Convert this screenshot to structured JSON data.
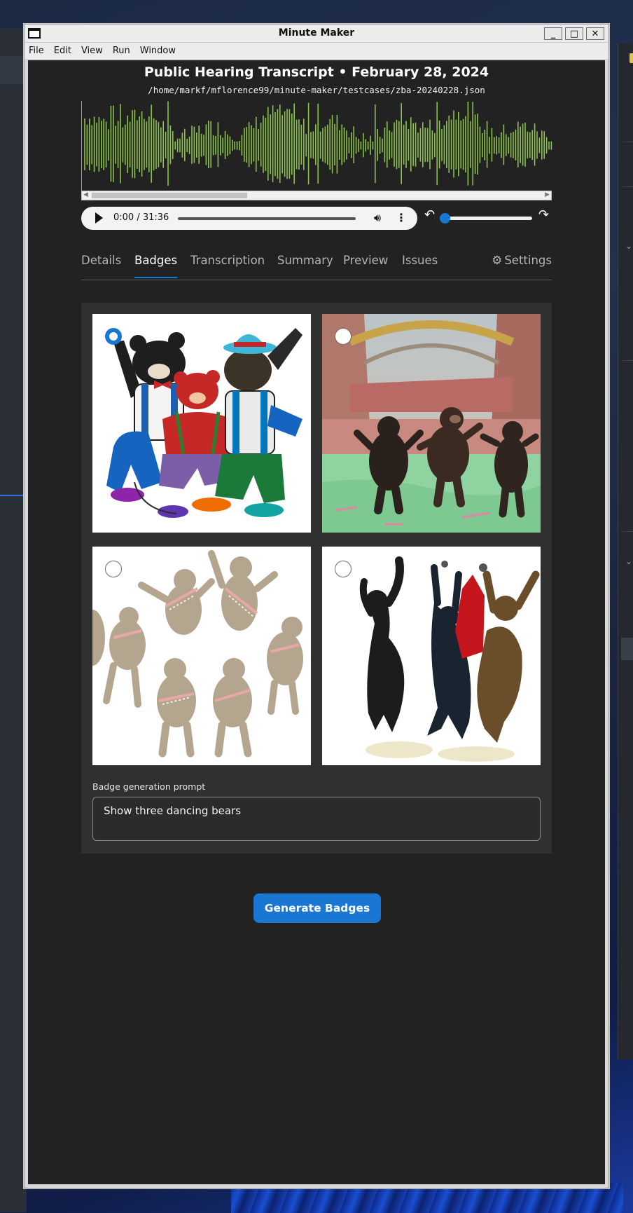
{
  "window": {
    "title": "Minute Maker",
    "controls": {
      "minimize": "_",
      "maximize": "□",
      "close": "✕"
    }
  },
  "menu": [
    "File",
    "Edit",
    "View",
    "Run",
    "Window"
  ],
  "document": {
    "title": "Public Hearing Transcript • February 28, 2024",
    "path": "/home/markf/mflorence99/minute-maker/testcases/zba-20240228.json"
  },
  "waveform": {
    "color": "#8bc34a"
  },
  "player": {
    "time": "0:00 / 31:36",
    "progress": 0
  },
  "tabs": [
    "Details",
    "Badges",
    "Transcription",
    "Summary",
    "Preview",
    "Issues"
  ],
  "active_tab": "Badges",
  "settings_label": "Settings",
  "badges": {
    "selected_index": 0,
    "images": [
      {
        "subject": "three-cartoon-bears-in-suspenders"
      },
      {
        "subject": "three-bears-dancing-in-ruins"
      },
      {
        "subject": "many-beige-bears-circle-dance"
      },
      {
        "subject": "three-dark-bears-leaping"
      }
    ],
    "prompt_label": "Badge generation prompt",
    "prompt_value": "Show three dancing bears"
  },
  "generate_button": "Generate Badges",
  "colors": {
    "accent": "#1976d2",
    "panel": "#303030",
    "background": "#222222"
  }
}
